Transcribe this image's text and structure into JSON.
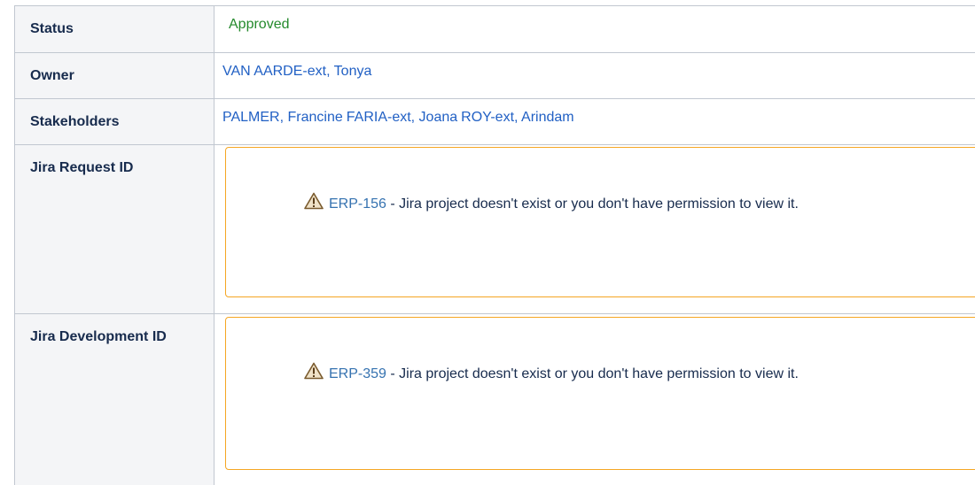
{
  "rows": {
    "status": {
      "label": "Status",
      "value": "Approved"
    },
    "owner": {
      "label": "Owner",
      "value": "VAN AARDE-ext, Tonya"
    },
    "stakeholders": {
      "label": "Stakeholders",
      "people": [
        "PALMER, Francine",
        "FARIA-ext, Joana",
        "ROY-ext, Arindam"
      ]
    },
    "jira_request": {
      "label": "Jira Request ID",
      "issue_key": "ERP-156",
      "message": " - Jira project doesn't exist or you don't have permission to view it."
    },
    "jira_development": {
      "label": "Jira Development ID",
      "issue_key": "ERP-359",
      "message": " - Jira project doesn't exist or you don't have permission to view it."
    }
  },
  "colors": {
    "status_approved": "#248a2c",
    "link": "#2160c4",
    "issue_link": "#3572b0",
    "warning_border": "#f5a623",
    "header_bg": "#f4f5f7",
    "cell_border": "#c1c7d0"
  },
  "icons": {
    "warning": "warning-triangle-icon"
  }
}
